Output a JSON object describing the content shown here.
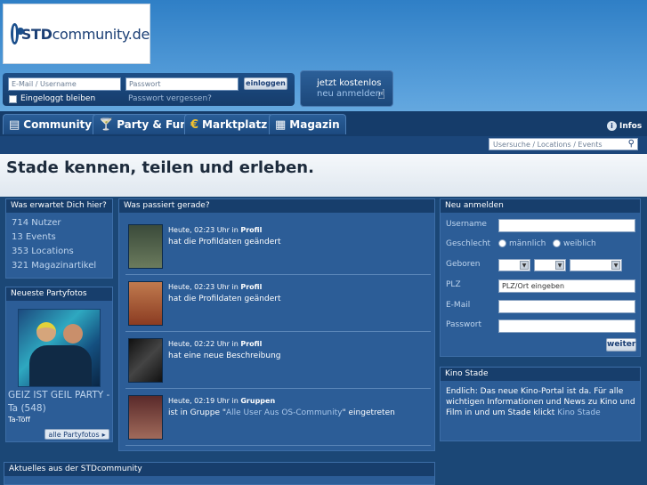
{
  "logo": {
    "brand_bold": "STD",
    "brand_rest": "community.de"
  },
  "login": {
    "email_placeholder": "E-Mail / Username",
    "password_placeholder": "Passwort",
    "login_button": "einloggen",
    "remember_label": "Eingeloggt bleiben",
    "forgot_link": "Passwort vergessen?"
  },
  "register_button": {
    "line1": "jetzt kostenlos",
    "line2": "neu anmelden"
  },
  "nav": {
    "tabs": [
      {
        "label": "Community",
        "icon": "community-icon"
      },
      {
        "label": "Party & Fun",
        "icon": "cocktail-icon"
      },
      {
        "label": "Marktplatz",
        "icon": "euro-icon"
      },
      {
        "label": "Magazin",
        "icon": "magazine-icon"
      }
    ],
    "infos_label": "Infos",
    "search_placeholder": "Usersuche / Locations / Events"
  },
  "headline": "Stade kennen, teilen und erleben.",
  "stats_box": {
    "title": "Was erwartet Dich hier?",
    "items": [
      "714 Nutzer",
      "13 Events",
      "353 Locations",
      "321 Magazinartikel"
    ]
  },
  "party_box": {
    "title": "Neueste Partyfotos",
    "photo_title": "GEIZ IST GEIL PARTY - Ta (548)",
    "photo_sub": "Ta-Töff",
    "all_button": "alle Partyfotos"
  },
  "feed_box": {
    "title": "Was passiert gerade?",
    "items": [
      {
        "time": "Heute, 02:23 Uhr in",
        "section": "Profil",
        "text": "hat die Profildaten geändert",
        "link": ""
      },
      {
        "time": "Heute, 02:23 Uhr in",
        "section": "Profil",
        "text": "hat die Profildaten geändert",
        "link": ""
      },
      {
        "time": "Heute, 02:22 Uhr in",
        "section": "Profil",
        "text": "hat eine neue Beschreibung",
        "link": ""
      },
      {
        "time": "Heute, 02:19 Uhr in",
        "section": "Gruppen",
        "text_pre": "ist in Gruppe \"",
        "link": "Alle User Aus OS-Community",
        "text_post": "\" eingetreten"
      }
    ]
  },
  "news_box": {
    "title": "Aktuelles aus der STDcommunity"
  },
  "register_box": {
    "title": "Neu anmelden",
    "username_label": "Username",
    "gender_label": "Geschlecht",
    "male": "männlich",
    "female": "weiblich",
    "birth_label": "Geboren",
    "plz_label": "PLZ",
    "plz_value": "PLZ/Ort eingeben",
    "email_label": "E-Mail",
    "password_label": "Passwort",
    "submit": "weiter"
  },
  "kino_box": {
    "title": "Kino Stade",
    "text": "Endlich: Das neue Kino-Portal ist da. Für alle wichtigen Informationen und News zu Kino und Film in und um Stade klickt",
    "link": "Kino Stade"
  },
  "colors": {
    "header_blue": "#153c6a",
    "panel_blue": "#2c5d97",
    "link_blue": "#a9c7ea"
  }
}
